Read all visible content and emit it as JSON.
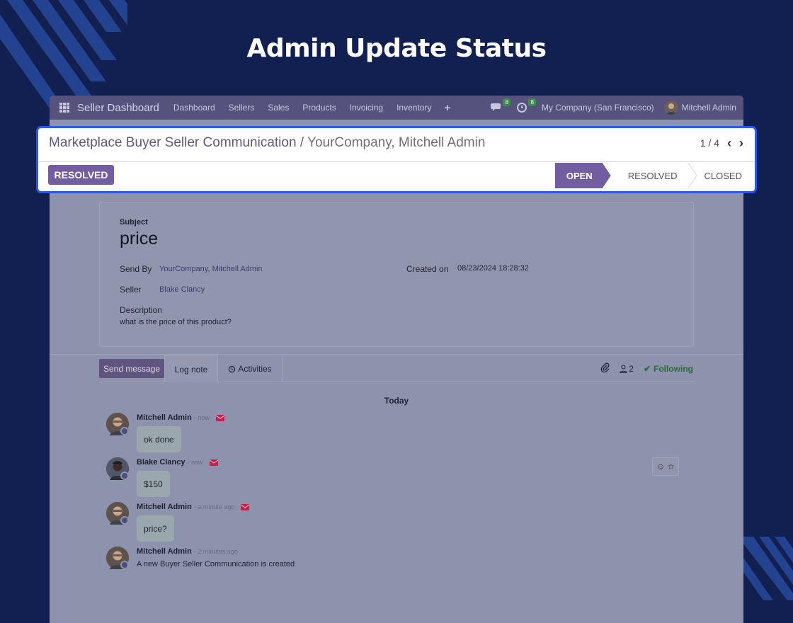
{
  "hero": {
    "title": "Admin Update Status"
  },
  "navbar": {
    "brand": "Seller Dashboard",
    "menu": [
      "Dashboard",
      "Sellers",
      "Sales",
      "Products",
      "Invoicing",
      "Inventory"
    ],
    "messages_count": "8",
    "activities_count": "8",
    "company": "My Company (San Francisco)",
    "user": "Mitchell Admin"
  },
  "control": {
    "breadcrumb_parent": "Marketplace Buyer Seller Communication",
    "breadcrumb_sep": "/",
    "breadcrumb_current": "YourCompany, Mitchell Admin",
    "pager_text": "1 / 4",
    "resolve_button": "RESOLVED",
    "stages": [
      "OPEN",
      "RESOLVED",
      "CLOSED"
    ],
    "active_stage": "OPEN"
  },
  "form": {
    "subject_label": "Subject",
    "subject_value": "price",
    "send_by_label": "Send By",
    "send_by_value": "YourCompany, Mitchell Admin",
    "created_on_label": "Created on",
    "created_on_value": "08/23/2024 18:28:32",
    "seller_label": "Seller",
    "seller_value": "Blake Clancy",
    "description_label": "Description",
    "description_value": "what is the price of this product?"
  },
  "chatter": {
    "send_message": "Send message",
    "log_note": "Log note",
    "activities": "Activities",
    "followers_count": "2",
    "following": "Following",
    "date_separator": "Today",
    "messages": [
      {
        "author": "Mitchell Admin",
        "time": "- now",
        "body": "ok done",
        "type": "bubble"
      },
      {
        "author": "Blake Clancy",
        "time": "- now",
        "body": "$150",
        "type": "bubble"
      },
      {
        "author": "Mitchell Admin",
        "time": "- a minute ago",
        "body": "price?",
        "type": "bubble"
      },
      {
        "author": "Mitchell Admin",
        "time": "- 2 minutes ago",
        "body": "A new Buyer Seller Communication is created",
        "type": "note"
      }
    ]
  },
  "colors": {
    "page_bg": "#112050",
    "accent": "#715d9f",
    "highlight_border": "#2f58e6",
    "following": "#2a6b36",
    "mail": "#c0234b"
  }
}
